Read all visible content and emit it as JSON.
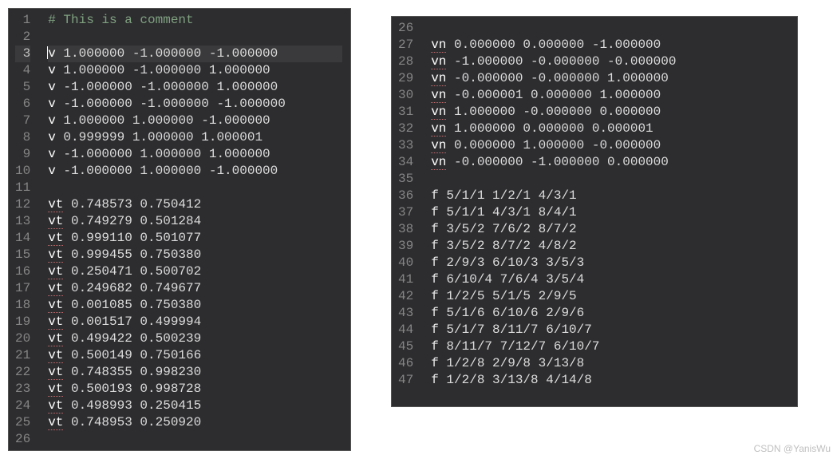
{
  "panes": [
    {
      "name": "left-editor",
      "activeLine": 3,
      "lines": [
        {
          "n": 1,
          "text": "# This is a comment",
          "kind": "comment"
        },
        {
          "n": 2,
          "text": "",
          "kind": "blank"
        },
        {
          "n": 3,
          "text": "v 1.000000 -1.000000 -1.000000",
          "kind": "v",
          "cursorAfter": ""
        },
        {
          "n": 4,
          "text": "v 1.000000 -1.000000 1.000000",
          "kind": "v"
        },
        {
          "n": 5,
          "text": "v -1.000000 -1.000000 1.000000",
          "kind": "v"
        },
        {
          "n": 6,
          "text": "v -1.000000 -1.000000 -1.000000",
          "kind": "v"
        },
        {
          "n": 7,
          "text": "v 1.000000 1.000000 -1.000000",
          "kind": "v"
        },
        {
          "n": 8,
          "text": "v 0.999999 1.000000 1.000001",
          "kind": "v"
        },
        {
          "n": 9,
          "text": "v -1.000000 1.000000 1.000000",
          "kind": "v"
        },
        {
          "n": 10,
          "text": "v -1.000000 1.000000 -1.000000",
          "kind": "v"
        },
        {
          "n": 11,
          "text": "",
          "kind": "blank"
        },
        {
          "n": 12,
          "text": "vt 0.748573 0.750412",
          "kind": "vt"
        },
        {
          "n": 13,
          "text": "vt 0.749279 0.501284",
          "kind": "vt"
        },
        {
          "n": 14,
          "text": "vt 0.999110 0.501077",
          "kind": "vt"
        },
        {
          "n": 15,
          "text": "vt 0.999455 0.750380",
          "kind": "vt"
        },
        {
          "n": 16,
          "text": "vt 0.250471 0.500702",
          "kind": "vt"
        },
        {
          "n": 17,
          "text": "vt 0.249682 0.749677",
          "kind": "vt"
        },
        {
          "n": 18,
          "text": "vt 0.001085 0.750380",
          "kind": "vt"
        },
        {
          "n": 19,
          "text": "vt 0.001517 0.499994",
          "kind": "vt"
        },
        {
          "n": 20,
          "text": "vt 0.499422 0.500239",
          "kind": "vt"
        },
        {
          "n": 21,
          "text": "vt 0.500149 0.750166",
          "kind": "vt"
        },
        {
          "n": 22,
          "text": "vt 0.748355 0.998230",
          "kind": "vt"
        },
        {
          "n": 23,
          "text": "vt 0.500193 0.998728",
          "kind": "vt"
        },
        {
          "n": 24,
          "text": "vt 0.498993 0.250415",
          "kind": "vt"
        },
        {
          "n": 25,
          "text": "vt 0.748953 0.250920",
          "kind": "vt"
        },
        {
          "n": 26,
          "text": "",
          "kind": "blank"
        }
      ]
    },
    {
      "name": "right-editor",
      "activeLine": null,
      "lines": [
        {
          "n": 26,
          "text": "",
          "kind": "blank"
        },
        {
          "n": 27,
          "text": "vn 0.000000 0.000000 -1.000000",
          "kind": "vn"
        },
        {
          "n": 28,
          "text": "vn -1.000000 -0.000000 -0.000000",
          "kind": "vn"
        },
        {
          "n": 29,
          "text": "vn -0.000000 -0.000000 1.000000",
          "kind": "vn"
        },
        {
          "n": 30,
          "text": "vn -0.000001 0.000000 1.000000",
          "kind": "vn"
        },
        {
          "n": 31,
          "text": "vn 1.000000 -0.000000 0.000000",
          "kind": "vn"
        },
        {
          "n": 32,
          "text": "vn 1.000000 0.000000 0.000001",
          "kind": "vn"
        },
        {
          "n": 33,
          "text": "vn 0.000000 1.000000 -0.000000",
          "kind": "vn"
        },
        {
          "n": 34,
          "text": "vn -0.000000 -1.000000 0.000000",
          "kind": "vn"
        },
        {
          "n": 35,
          "text": "",
          "kind": "blank"
        },
        {
          "n": 36,
          "text": "f 5/1/1 1/2/1 4/3/1",
          "kind": "f"
        },
        {
          "n": 37,
          "text": "f 5/1/1 4/3/1 8/4/1",
          "kind": "f"
        },
        {
          "n": 38,
          "text": "f 3/5/2 7/6/2 8/7/2",
          "kind": "f"
        },
        {
          "n": 39,
          "text": "f 3/5/2 8/7/2 4/8/2",
          "kind": "f"
        },
        {
          "n": 40,
          "text": "f 2/9/3 6/10/3 3/5/3",
          "kind": "f"
        },
        {
          "n": 41,
          "text": "f 6/10/4 7/6/4 3/5/4",
          "kind": "f"
        },
        {
          "n": 42,
          "text": "f 1/2/5 5/1/5 2/9/5",
          "kind": "f"
        },
        {
          "n": 43,
          "text": "f 5/1/6 6/10/6 2/9/6",
          "kind": "f"
        },
        {
          "n": 44,
          "text": "f 5/1/7 8/11/7 6/10/7",
          "kind": "f"
        },
        {
          "n": 45,
          "text": "f 8/11/7 7/12/7 6/10/7",
          "kind": "f"
        },
        {
          "n": 46,
          "text": "f 1/2/8 2/9/8 3/13/8",
          "kind": "f"
        },
        {
          "n": 47,
          "text": "f 1/2/8 3/13/8 4/14/8",
          "kind": "f"
        }
      ]
    }
  ],
  "watermark": "CSDN @YanisWu"
}
